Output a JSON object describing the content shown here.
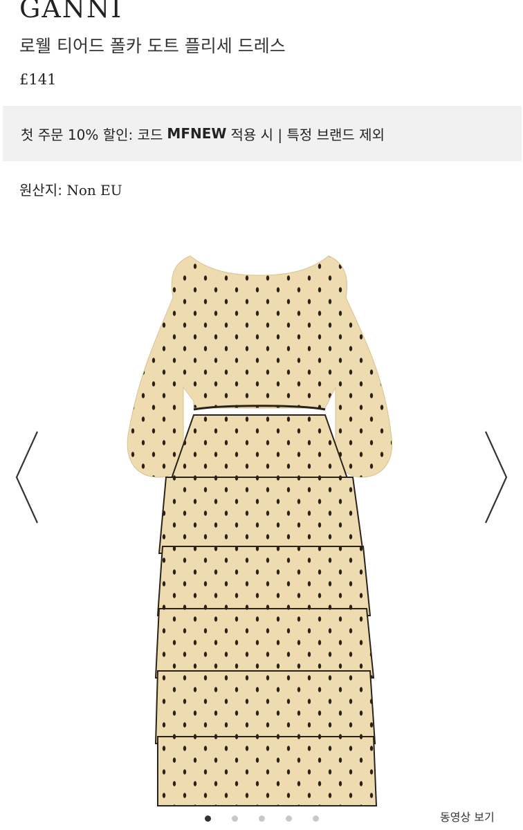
{
  "product": {
    "brand": "GANNI",
    "name": "로웰 티어드 폴카 도트 플리세 드레스",
    "price": "£141"
  },
  "promo": {
    "prefix": "첫 주문 10% 할인: 코드",
    "code": "MFNEW",
    "suffix": "적용 시 | 특정 브랜드 제외"
  },
  "origin": {
    "label": "원산지:",
    "value": "Non EU"
  },
  "gallery": {
    "image_icon": "polka-dot-tiered-dress-image",
    "prev_icon": "chevron-left-icon",
    "next_icon": "chevron-right-icon",
    "slide_count": 5,
    "active_slide": 1,
    "video_label": "동영상 보기",
    "dress_color": "#eedcb0",
    "dot_color": "#2a2218"
  }
}
